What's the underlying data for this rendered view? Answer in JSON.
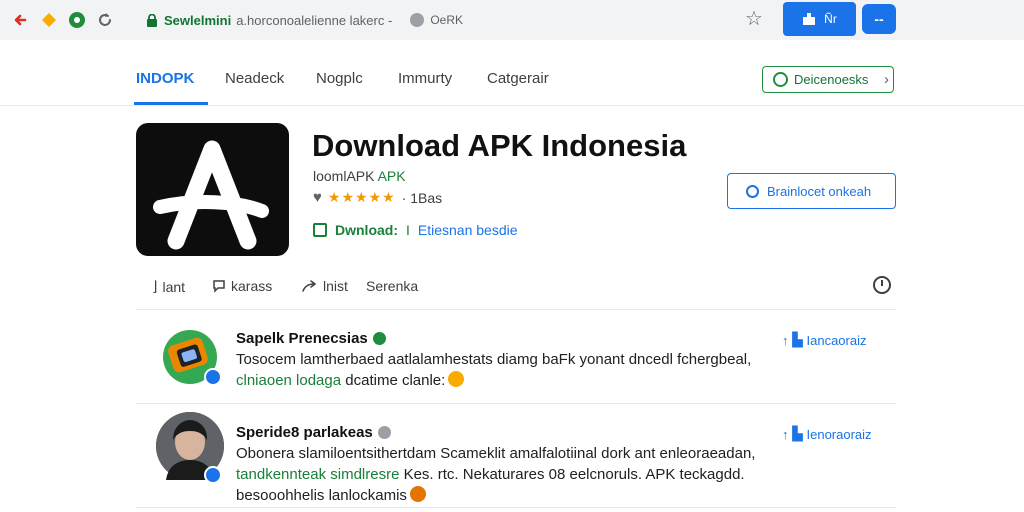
{
  "browser": {
    "address": {
      "secure_text": "Sewlelmini",
      "url": "a.horconoalelienne lakerc -",
      "site_chip": "OeRK"
    },
    "extension_label": "Ñr",
    "menu_label": "--"
  },
  "nav": {
    "items": [
      {
        "label": "INDOPK",
        "active": true
      },
      {
        "label": "Neadeck"
      },
      {
        "label": "Nogplc"
      },
      {
        "label": "Immurty"
      },
      {
        "label": "Catgerair"
      }
    ],
    "top_button_label": "Deicenoesks"
  },
  "app": {
    "title": "Download APK Indonesia",
    "subtitle_prefix": "loomlAPK",
    "subtitle_green": "APK",
    "stars_display": "★★★★★",
    "rating_count": "· 1Bas",
    "download_label": "Dwnload:",
    "download_sep": "I",
    "download_link": "Etiesnan besdie",
    "cta_label": "Brainlocet onkeah"
  },
  "actions": [
    {
      "label": "lant"
    },
    {
      "label": "karass"
    },
    {
      "label": "lnist"
    },
    {
      "label": "Serenka"
    }
  ],
  "reviews": [
    {
      "name": "Sapelk Prenecsias",
      "text_main": "Tosocem lamtherbaed aatlalamhestats diamg baFk yonant dncedl fchergbeal,",
      "text_hl": "clniaoen lodaga",
      "text_tail": " dcatime clanle:",
      "helpful_label": "Iancaoraiz"
    },
    {
      "name": "Speride8 parlakeas",
      "text_main": "Obonera slamiloentsithertdam Scameklit amalfalotiinal dork ant enleoraeadan,",
      "text_hl": "tandkennteak simdlresre",
      "text_tail": " Kes. rtc. Nekaturares 08 eelcnoruls. APK teckagdd.",
      "text_last": "besooohhelis lanlockamis",
      "helpful_label": "Ienoraoraiz"
    }
  ],
  "colors": {
    "accent_blue": "#1a73e8",
    "accent_green": "#188038",
    "star_orange": "#f29900"
  }
}
